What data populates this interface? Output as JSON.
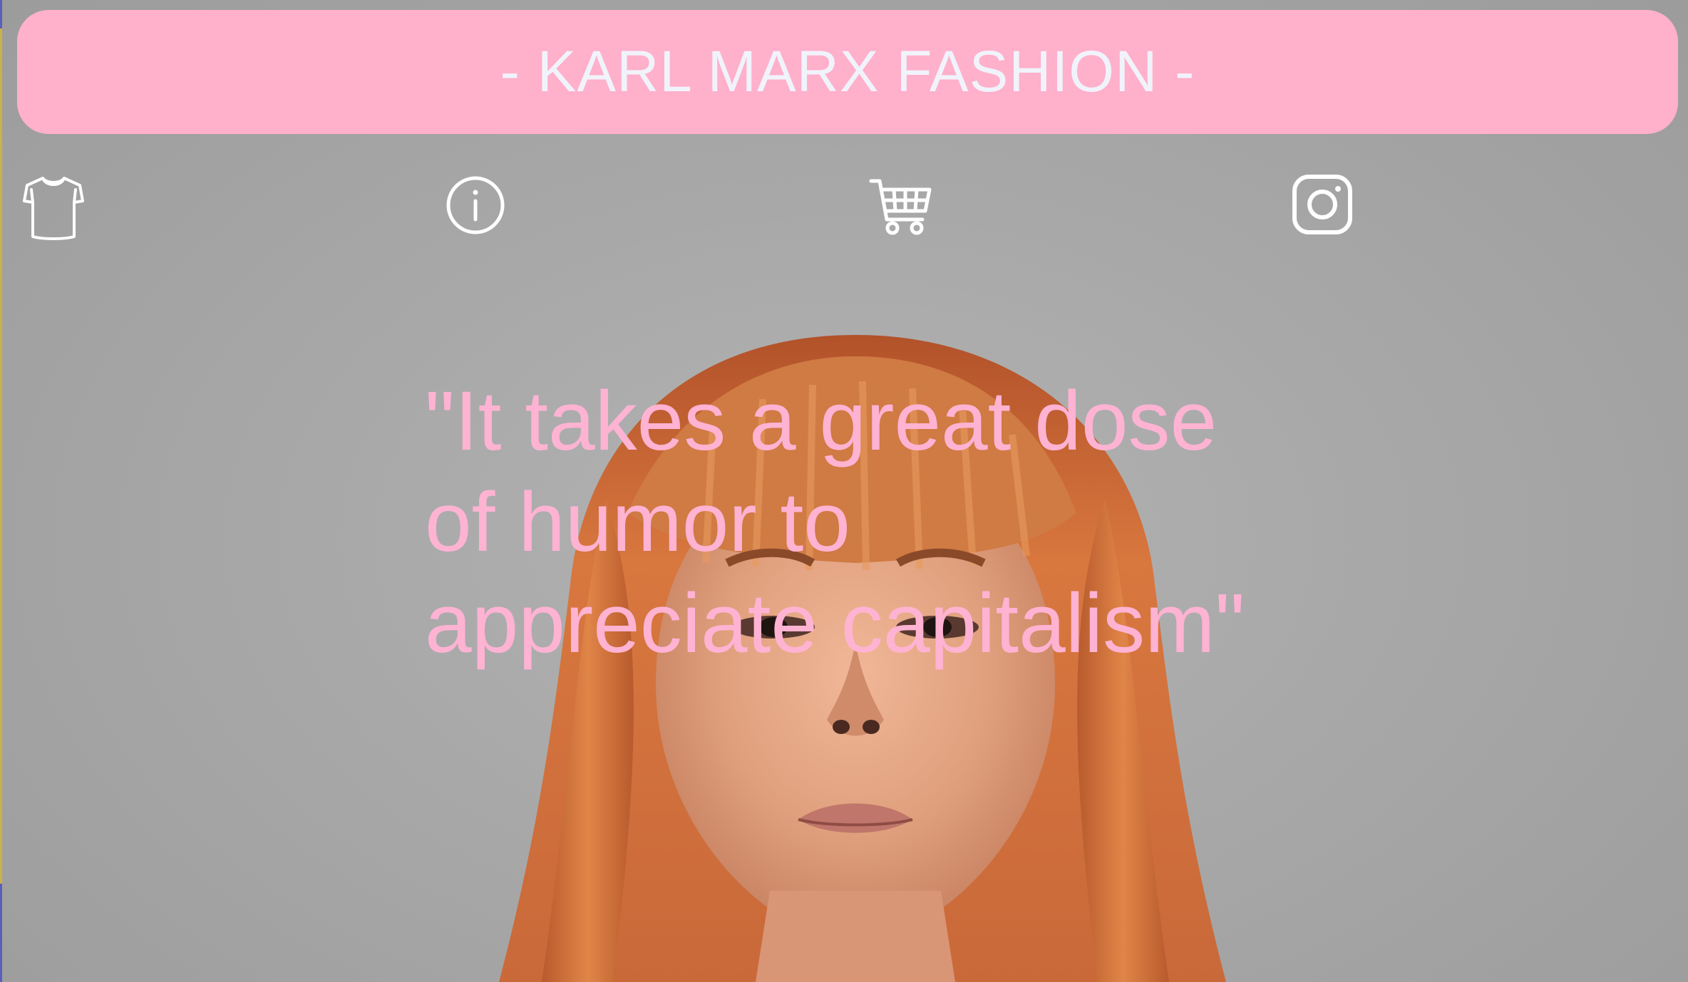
{
  "header": {
    "title": "- KARL MARX FASHION -"
  },
  "nav": {
    "items": [
      {
        "icon": "tshirt-icon"
      },
      {
        "icon": "info-icon"
      },
      {
        "icon": "shopping-cart-icon"
      },
      {
        "icon": "instagram-icon"
      }
    ]
  },
  "hero": {
    "quote_lines": [
      "\"It takes a great dose",
      "of humor to",
      "appreciate capitalism\""
    ]
  },
  "colors": {
    "background": "#a6a6a6",
    "accent_pink": "#ffb0cb",
    "header_text": "#f1f3fb",
    "quote_text": "#ffb3d3",
    "icon_color": "#ffffff"
  }
}
